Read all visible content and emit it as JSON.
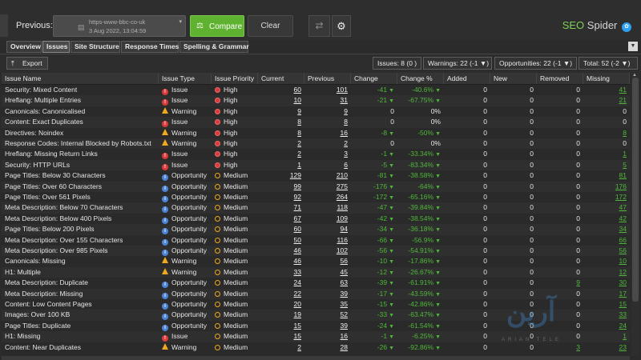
{
  "toolbar_top": {
    "previous_label": "Previous:",
    "crawl_url": "https-www-bbc-co-uk",
    "crawl_date": "3 Aug 2022, 13:04:59",
    "compare_label": "Compare",
    "clear_label": "Clear",
    "brand_part1": "SEO",
    "brand_part2": "Spider",
    "brand_icon": "twitter-bird-icon",
    "swap_icon": "swap-arrows-icon",
    "settings_icon": "gear-icon"
  },
  "tabs": [
    {
      "label": "Overview",
      "active": false
    },
    {
      "label": "Issues",
      "active": true
    },
    {
      "label": "Site Structure",
      "active": false
    },
    {
      "label": "Response Times",
      "active": false
    },
    {
      "label": "Spelling & Grammar",
      "active": false
    }
  ],
  "toolbar": {
    "export_label": "Export",
    "filters": [
      "Issues: 8 (0 )",
      "Warnings: 22 (-1 ▼)",
      "Opportunities: 22 (-1 ▼)",
      "Total: 52 (-2 ▼)"
    ]
  },
  "table": {
    "columns": [
      "Issue Name",
      "Issue Type",
      "Issue Priority",
      "Current",
      "Previous",
      "Change",
      "Change %",
      "Added",
      "New",
      "Removed",
      "Missing"
    ],
    "rows": [
      {
        "name": "Security: Mixed Content",
        "type": "Issue",
        "priority": "High",
        "current": "60",
        "previous": "101",
        "change": "-41",
        "change_pct": "-40.6%",
        "added": "0",
        "new": "0",
        "removed": "0",
        "missing": "41"
      },
      {
        "name": "Hreflang: Multiple Entries",
        "type": "Issue",
        "priority": "High",
        "current": "10",
        "previous": "31",
        "change": "-21",
        "change_pct": "-67.75%",
        "added": "0",
        "new": "0",
        "removed": "0",
        "missing": "21"
      },
      {
        "name": "Canonicals: Canonicalised",
        "type": "Warning",
        "priority": "High",
        "current": "9",
        "previous": "9",
        "change": "0",
        "change_pct": "0%",
        "added": "0",
        "new": "0",
        "removed": "0",
        "missing": "0"
      },
      {
        "name": "Content: Exact Duplicates",
        "type": "Issue",
        "priority": "High",
        "current": "8",
        "previous": "8",
        "change": "0",
        "change_pct": "0%",
        "added": "0",
        "new": "0",
        "removed": "0",
        "missing": "0"
      },
      {
        "name": "Directives: Noindex",
        "type": "Warning",
        "priority": "High",
        "current": "8",
        "previous": "16",
        "change": "-8",
        "change_pct": "-50%",
        "added": "0",
        "new": "0",
        "removed": "0",
        "missing": "8"
      },
      {
        "name": "Response Codes: Internal Blocked by Robots.txt",
        "type": "Warning",
        "priority": "High",
        "current": "2",
        "previous": "2",
        "change": "0",
        "change_pct": "0%",
        "added": "0",
        "new": "0",
        "removed": "0",
        "missing": "0"
      },
      {
        "name": "Hreflang: Missing Return Links",
        "type": "Issue",
        "priority": "High",
        "current": "2",
        "previous": "3",
        "change": "-1",
        "change_pct": "-33.34%",
        "added": "0",
        "new": "0",
        "removed": "0",
        "missing": "1"
      },
      {
        "name": "Security: HTTP URLs",
        "type": "Issue",
        "priority": "High",
        "current": "1",
        "previous": "6",
        "change": "-5",
        "change_pct": "-83.34%",
        "added": "0",
        "new": "0",
        "removed": "0",
        "missing": "5"
      },
      {
        "name": "Page Titles: Below 30 Characters",
        "type": "Opportunity",
        "priority": "Medium",
        "current": "129",
        "previous": "210",
        "change": "-81",
        "change_pct": "-38.58%",
        "added": "0",
        "new": "0",
        "removed": "0",
        "missing": "81"
      },
      {
        "name": "Page Titles: Over 60 Characters",
        "type": "Opportunity",
        "priority": "Medium",
        "current": "99",
        "previous": "275",
        "change": "-176",
        "change_pct": "-64%",
        "added": "0",
        "new": "0",
        "removed": "0",
        "missing": "176"
      },
      {
        "name": "Page Titles: Over 561 Pixels",
        "type": "Opportunity",
        "priority": "Medium",
        "current": "92",
        "previous": "264",
        "change": "-172",
        "change_pct": "-65.16%",
        "added": "0",
        "new": "0",
        "removed": "0",
        "missing": "172"
      },
      {
        "name": "Meta Description: Below 70 Characters",
        "type": "Opportunity",
        "priority": "Medium",
        "current": "71",
        "previous": "118",
        "change": "-47",
        "change_pct": "-39.84%",
        "added": "0",
        "new": "0",
        "removed": "0",
        "missing": "47"
      },
      {
        "name": "Meta Description: Below 400 Pixels",
        "type": "Opportunity",
        "priority": "Medium",
        "current": "67",
        "previous": "109",
        "change": "-42",
        "change_pct": "-38.54%",
        "added": "0",
        "new": "0",
        "removed": "0",
        "missing": "42"
      },
      {
        "name": "Page Titles: Below 200 Pixels",
        "type": "Opportunity",
        "priority": "Medium",
        "current": "60",
        "previous": "94",
        "change": "-34",
        "change_pct": "-36.18%",
        "added": "0",
        "new": "0",
        "removed": "0",
        "missing": "34"
      },
      {
        "name": "Meta Description: Over 155 Characters",
        "type": "Opportunity",
        "priority": "Medium",
        "current": "50",
        "previous": "116",
        "change": "-66",
        "change_pct": "-56.9%",
        "added": "0",
        "new": "0",
        "removed": "0",
        "missing": "66"
      },
      {
        "name": "Meta Description: Over 985 Pixels",
        "type": "Opportunity",
        "priority": "Medium",
        "current": "46",
        "previous": "102",
        "change": "-56",
        "change_pct": "-54.91%",
        "added": "0",
        "new": "0",
        "removed": "0",
        "missing": "56"
      },
      {
        "name": "Canonicals: Missing",
        "type": "Warning",
        "priority": "Medium",
        "current": "46",
        "previous": "56",
        "change": "-10",
        "change_pct": "-17.86%",
        "added": "0",
        "new": "0",
        "removed": "0",
        "missing": "10"
      },
      {
        "name": "H1: Multiple",
        "type": "Warning",
        "priority": "Medium",
        "current": "33",
        "previous": "45",
        "change": "-12",
        "change_pct": "-26.67%",
        "added": "0",
        "new": "0",
        "removed": "0",
        "missing": "12"
      },
      {
        "name": "Meta Description: Duplicate",
        "type": "Opportunity",
        "priority": "Medium",
        "current": "24",
        "previous": "63",
        "change": "-39",
        "change_pct": "-61.91%",
        "added": "0",
        "new": "0",
        "removed": "9",
        "missing": "30"
      },
      {
        "name": "Meta Description: Missing",
        "type": "Opportunity",
        "priority": "Medium",
        "current": "22",
        "previous": "39",
        "change": "-17",
        "change_pct": "-43.59%",
        "added": "0",
        "new": "0",
        "removed": "0",
        "missing": "17"
      },
      {
        "name": "Content: Low Content Pages",
        "type": "Opportunity",
        "priority": "Medium",
        "current": "20",
        "previous": "35",
        "change": "-15",
        "change_pct": "-42.86%",
        "added": "0",
        "new": "0",
        "removed": "0",
        "missing": "15"
      },
      {
        "name": "Images: Over 100 KB",
        "type": "Opportunity",
        "priority": "Medium",
        "current": "19",
        "previous": "52",
        "change": "-33",
        "change_pct": "-63.47%",
        "added": "0",
        "new": "0",
        "removed": "0",
        "missing": "33"
      },
      {
        "name": "Page Titles: Duplicate",
        "type": "Opportunity",
        "priority": "Medium",
        "current": "15",
        "previous": "39",
        "change": "-24",
        "change_pct": "-61.54%",
        "added": "0",
        "new": "0",
        "removed": "0",
        "missing": "24"
      },
      {
        "name": "H1: Missing",
        "type": "Issue",
        "priority": "Medium",
        "current": "15",
        "previous": "16",
        "change": "-1",
        "change_pct": "-6.25%",
        "added": "0",
        "new": "0",
        "removed": "0",
        "missing": "1"
      },
      {
        "name": "Content: Near Duplicates",
        "type": "Warning",
        "priority": "Medium",
        "current": "2",
        "previous": "28",
        "change": "-26",
        "change_pct": "-92.86%",
        "added": "0",
        "new": "0",
        "removed": "3",
        "missing": "23"
      }
    ]
  },
  "watermark": {
    "big": "آرین",
    "small": "ARIAN TELE"
  },
  "colors": {
    "accent_green": "#5fb230",
    "issue_red": "#d93a3a",
    "warning_orange": "#f0a81c",
    "opportunity_blue": "#4b84d6",
    "brand_blue": "#2ea0f2"
  }
}
